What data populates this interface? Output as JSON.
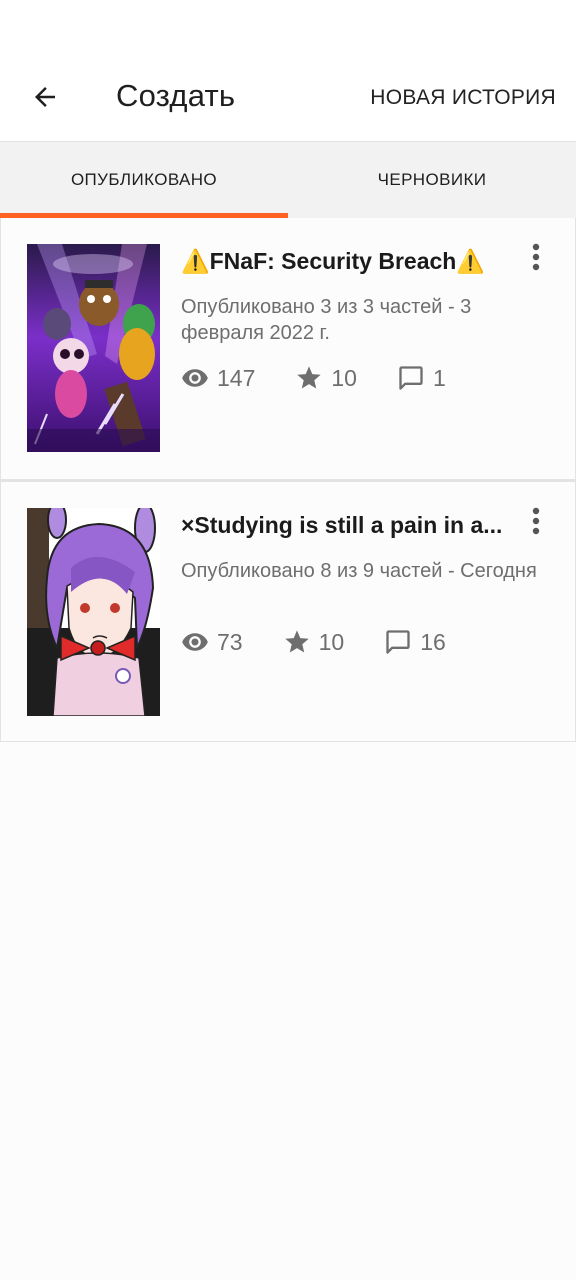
{
  "header": {
    "title": "Создать",
    "new_story_label": "НОВАЯ ИСТОРИЯ",
    "back_icon": "arrow-left-icon"
  },
  "tabs": [
    {
      "label": "ОПУБЛИКОВАНО",
      "active": true
    },
    {
      "label": "ЧЕРНОВИКИ",
      "active": false
    }
  ],
  "colors": {
    "accent": "#ff6122",
    "text_secondary": "#6e6e6e",
    "divider": "#e3e3e3"
  },
  "stories": [
    {
      "title": "⚠️FNaF: Security Breach⚠️",
      "meta": "Опубликовано 3 из 3 частей - 3 февраля 2022 г.",
      "views": "147",
      "votes": "10",
      "comments": "1"
    },
    {
      "title": "×Studying is still a pain in a...",
      "meta": "Опубликовано 8 из 9 частей - Сегодня",
      "views": "73",
      "votes": "10",
      "comments": "16"
    }
  ]
}
